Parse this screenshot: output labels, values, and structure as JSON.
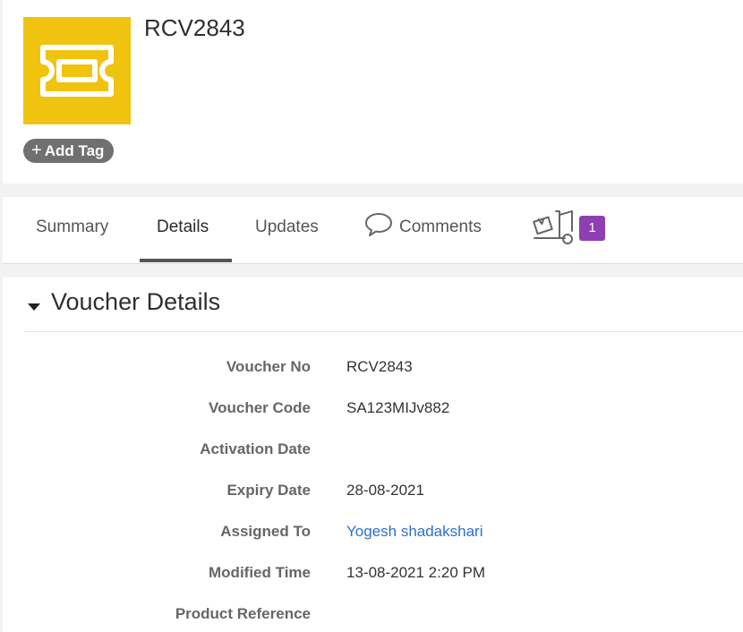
{
  "record": {
    "title": "RCV2843",
    "add_tag_label": "Add Tag",
    "thumb_color": "#f0c30f",
    "thumb_icon": "ticket-icon"
  },
  "tabs": [
    {
      "label": "Summary",
      "active": false
    },
    {
      "label": "Details",
      "active": true
    },
    {
      "label": "Updates",
      "active": false
    },
    {
      "label": "Comments",
      "icon": "speech-bubble-icon",
      "active": false
    },
    {
      "label": "",
      "icon": "hand-truck-icon",
      "badge": "1",
      "active": false
    }
  ],
  "section": {
    "title": "Voucher Details",
    "fields": [
      {
        "label": "Voucher No",
        "value": "RCV2843"
      },
      {
        "label": "Voucher Code",
        "value": "SA123MIJv882"
      },
      {
        "label": "Activation Date",
        "value": ""
      },
      {
        "label": "Expiry Date",
        "value": "28-08-2021"
      },
      {
        "label": "Assigned To",
        "value": "Yogesh shadakshari",
        "link": true
      },
      {
        "label": "Modified Time",
        "value": "13-08-2021 2:20 PM"
      },
      {
        "label": "Product Reference",
        "value": ""
      }
    ]
  },
  "colors": {
    "badge": "#8e3fb3",
    "link": "#2e6fcf"
  }
}
